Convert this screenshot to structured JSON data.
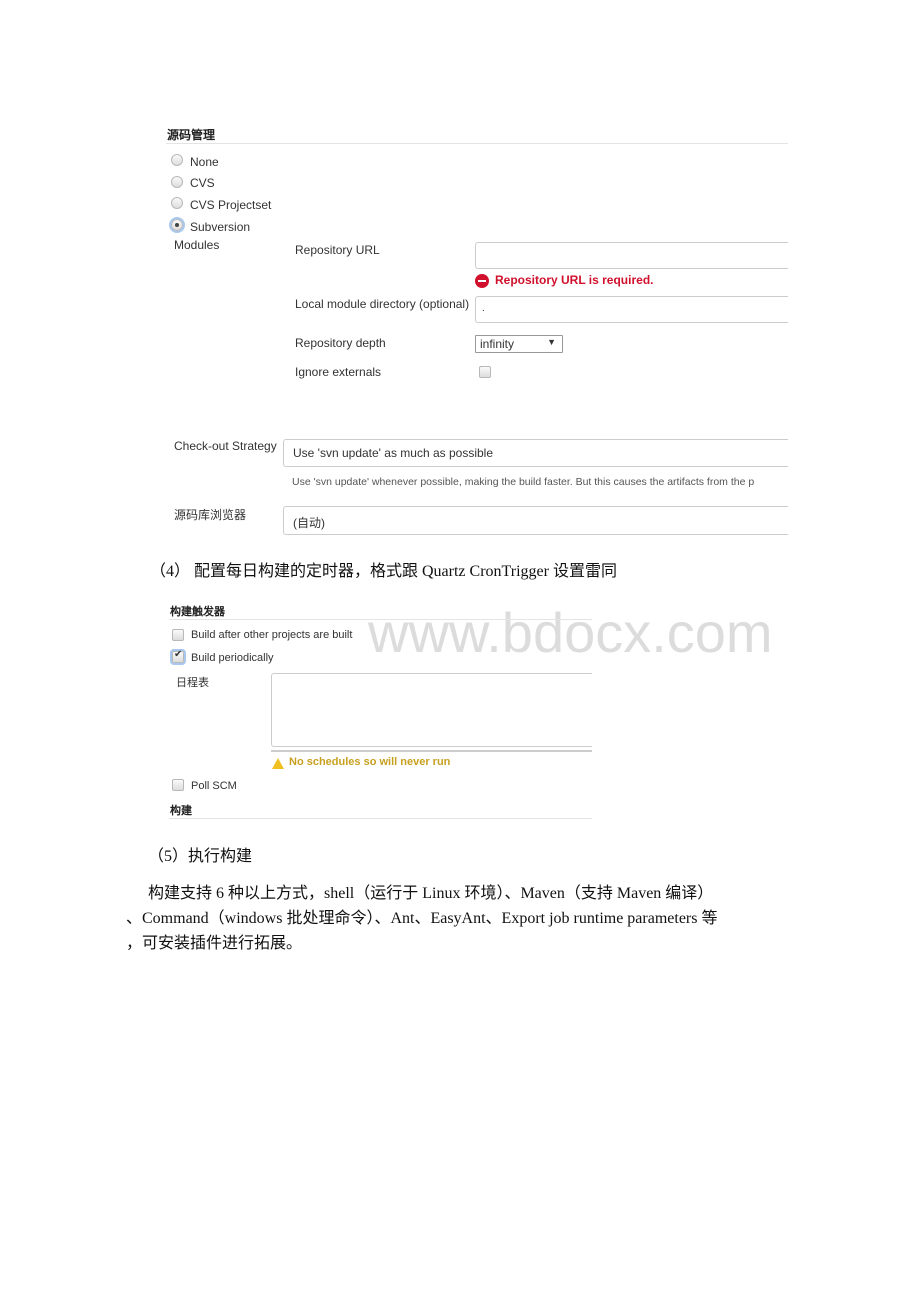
{
  "scm": {
    "heading": "源码管理",
    "options": [
      "None",
      "CVS",
      "CVS Projectset",
      "Subversion"
    ],
    "selected": "Subversion",
    "modules_label": "Modules",
    "repo_url_label": "Repository URL",
    "repo_url_value": "",
    "repo_url_error": "Repository URL is required.",
    "local_dir_label": "Local module directory (optional)",
    "local_dir_value": ".",
    "depth_label": "Repository depth",
    "depth_value": "infinity",
    "ignore_externals_label": "Ignore externals",
    "ignore_externals_checked": false,
    "checkout_label": "Check-out Strategy",
    "checkout_value": "Use 'svn update' as much as possible",
    "checkout_help": "Use 'svn update' whenever possible, making the build faster. But this causes the artifacts from the p",
    "browser_label": "源码库浏览器",
    "browser_value": "(自动)"
  },
  "doc": {
    "step4": "（4） 配置每日构建的定时器，格式跟 Quartz CronTrigger 设置雷同",
    "step5": "（5）执行构建",
    "para_line1": "构建支持 6 种以上方式，shell（运行于 Linux 环境）、Maven（支持 Maven 编译）",
    "para_line2": "、Command（windows 批处理命令）、Ant、EasyAnt、Export job runtime parameters 等",
    "para_line3": "，可安装插件进行拓展。"
  },
  "triggers": {
    "heading": "构建触发器",
    "after_other": "Build after other projects are built",
    "after_other_checked": false,
    "periodically": "Build periodically",
    "periodically_checked": true,
    "schedule_label": "日程表",
    "schedule_value": "",
    "warning": "No schedules so will never run",
    "poll_scm": "Poll SCM",
    "poll_scm_checked": false,
    "next_heading": "构建"
  },
  "watermark": "www.bdocx.com",
  "colors": {
    "error": "#d0102c",
    "warning": "#c8a020",
    "watermark": "#dcdcdc"
  }
}
